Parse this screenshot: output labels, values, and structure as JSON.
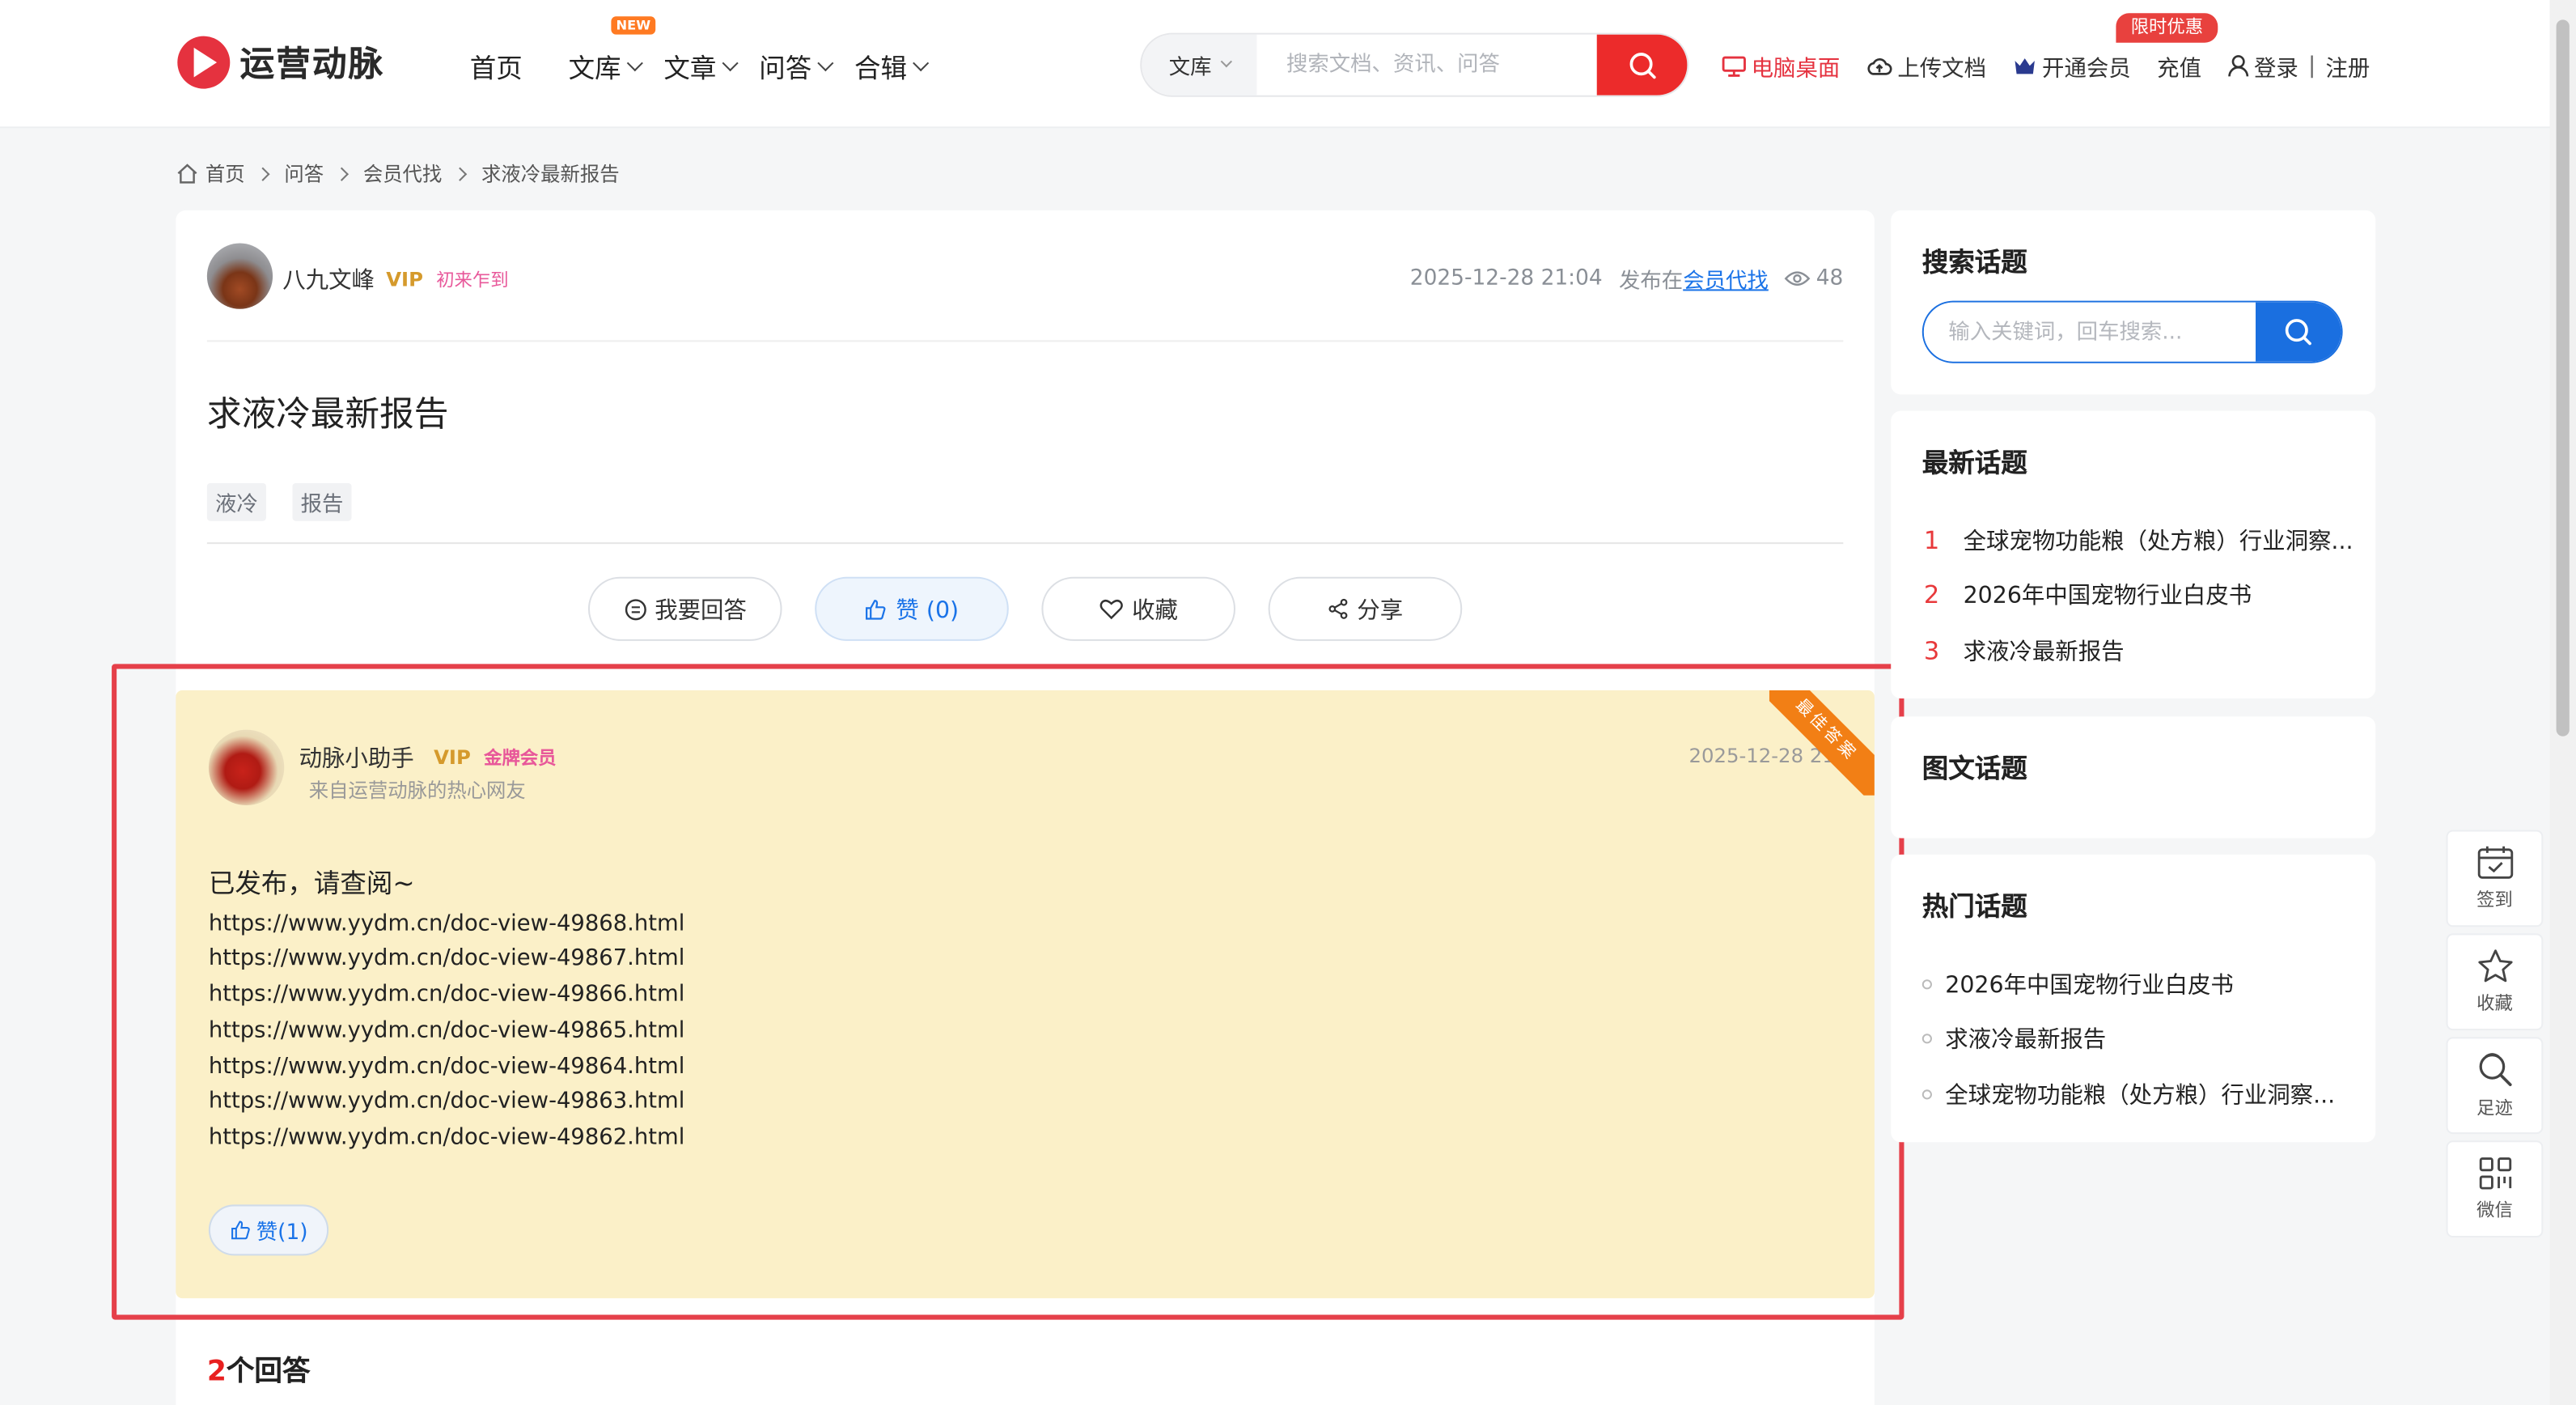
{
  "header": {
    "logo_text": "运营动脉",
    "nav": [
      {
        "label": "首页"
      },
      {
        "label": "文库",
        "badge": "NEW"
      },
      {
        "label": "文章"
      },
      {
        "label": "问答"
      },
      {
        "label": "合辑"
      }
    ],
    "search": {
      "category": "文库",
      "placeholder": "搜索文档、资讯、问答"
    },
    "links": {
      "desktop": "电脑桌面",
      "upload": "上传文档",
      "vip": "开通会员",
      "recharge": "充值",
      "login": "登录",
      "separator": "|",
      "register": "注册",
      "promo_badge": "限时优惠"
    }
  },
  "breadcrumb": [
    "首页",
    "问答",
    "会员代找",
    "求液冷最新报告"
  ],
  "question": {
    "author": "八九文峰",
    "vip": "VIP",
    "rank": "初来乍到",
    "time": "2025-12-28 21:04",
    "published_in": "发布在",
    "category": "会员代找",
    "views": "48",
    "title": "求液冷最新报告",
    "tags": [
      "液冷",
      "报告"
    ],
    "actions": {
      "answer": "我要回答",
      "like": "赞 (0)",
      "collect": "收藏",
      "share": "分享"
    }
  },
  "best_answer": {
    "author": "动脉小助手",
    "vip": "VIP",
    "rank": "金牌会员",
    "subtitle": "来自运营动脉的热心网友",
    "time": "2025-12-28 21:5",
    "ribbon": "最佳答案",
    "first_line": "已发布，请查阅~",
    "links": [
      "https://www.yydm.cn/doc-view-49868.html",
      "https://www.yydm.cn/doc-view-49867.html",
      "https://www.yydm.cn/doc-view-49866.html",
      "https://www.yydm.cn/doc-view-49865.html",
      "https://www.yydm.cn/doc-view-49864.html",
      "https://www.yydm.cn/doc-view-49863.html",
      "https://www.yydm.cn/doc-view-49862.html"
    ],
    "like": "赞(1)"
  },
  "answers_count": {
    "num": "2",
    "label": "个回答"
  },
  "sidebar": {
    "search": {
      "title": "搜索话题",
      "placeholder": "输入关键词，回车搜索..."
    },
    "latest": {
      "title": "最新话题",
      "items": [
        {
          "n": "1",
          "text": "全球宠物功能粮（处方粮）行业洞察..."
        },
        {
          "n": "2",
          "text": "2026年中国宠物行业白皮书"
        },
        {
          "n": "3",
          "text": "求液冷最新报告"
        }
      ]
    },
    "image_topics": {
      "title": "图文话题"
    },
    "hot": {
      "title": "热门话题",
      "items": [
        "2026年中国宠物行业白皮书",
        "求液冷最新报告",
        "全球宠物功能粮（处方粮）行业洞察..."
      ]
    }
  },
  "float_bar": {
    "checkin": "签到",
    "collect": "收藏",
    "footprint": "足迹",
    "wechat": "微信"
  },
  "colors": {
    "brand_red": "#e5323f",
    "link_blue": "#1a73e8",
    "answer_bg": "#fbf0c8",
    "ribbon_orange": "#f27f15",
    "highlight_border": "#e5404a"
  }
}
